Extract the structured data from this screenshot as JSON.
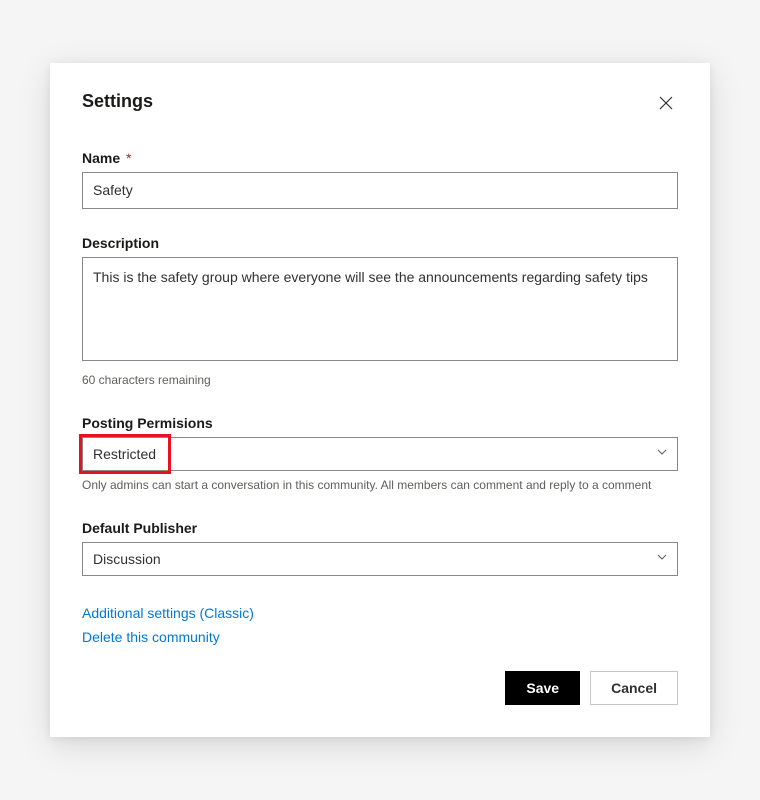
{
  "dialog": {
    "title": "Settings"
  },
  "fields": {
    "name": {
      "label": "Name",
      "required_mark": "*",
      "value": "Safety"
    },
    "description": {
      "label": "Description",
      "value": "This is the safety group where everyone will see the announcements regarding safety tips",
      "remaining": "60 characters remaining"
    },
    "posting": {
      "label": "Posting Permisions",
      "value": "Restricted",
      "helper": "Only admins can start a conversation in this community. All members can comment and reply to a comment"
    },
    "publisher": {
      "label": "Default Publisher",
      "value": "Discussion"
    }
  },
  "links": {
    "additional": "Additional settings (Classic)",
    "delete": "Delete this community"
  },
  "buttons": {
    "save": "Save",
    "cancel": "Cancel"
  }
}
